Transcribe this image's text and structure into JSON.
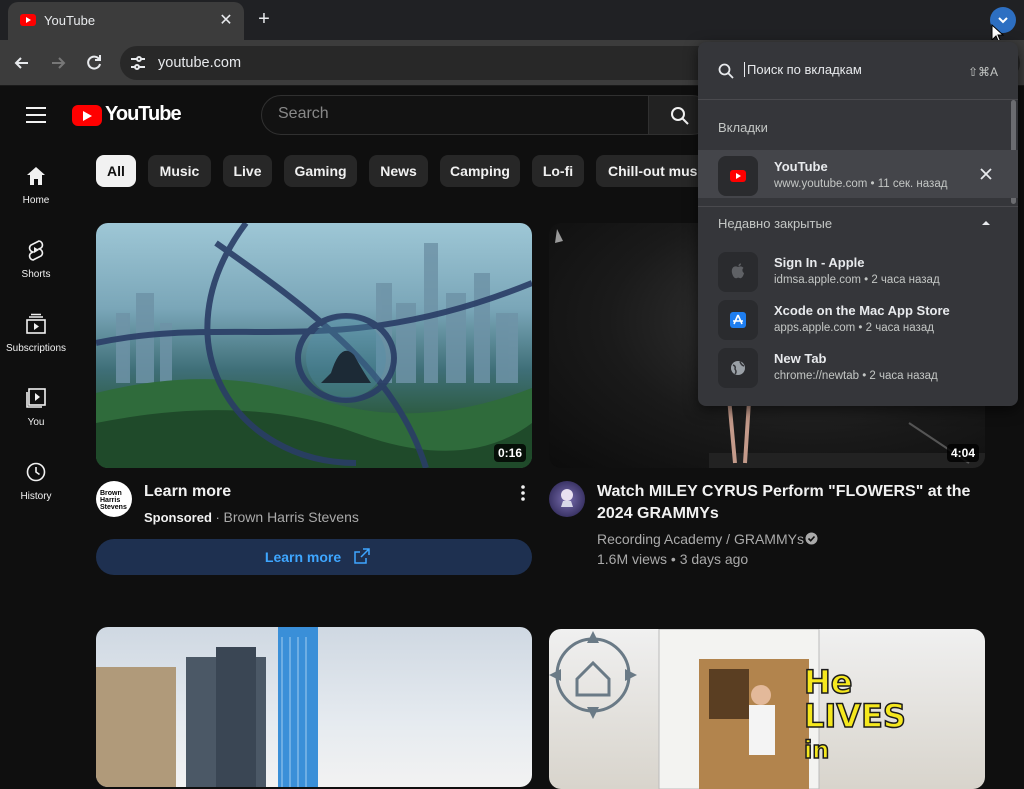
{
  "browser": {
    "tab_title": "YouTube",
    "tab_close": "✕",
    "new_tab": "+",
    "url": "youtube.com"
  },
  "youtube": {
    "logo_text": "YouTube",
    "search_placeholder": "Search",
    "sidebar": [
      {
        "label": "Home",
        "icon": "home-icon"
      },
      {
        "label": "Shorts",
        "icon": "shorts-icon"
      },
      {
        "label": "Subscriptions",
        "icon": "subscriptions-icon"
      },
      {
        "label": "You",
        "icon": "you-icon"
      },
      {
        "label": "History",
        "icon": "history-icon"
      }
    ],
    "chips": [
      "All",
      "Music",
      "Live",
      "Gaming",
      "News",
      "Camping",
      "Lo-fi",
      "Chill-out music"
    ],
    "videos": [
      {
        "title": "Learn more",
        "sponsored": "Sponsored",
        "dot": "·",
        "advertiser": "Brown Harris Stevens",
        "avatar_text": "Brown Harris Stevens",
        "duration": "0:16",
        "cta": "Learn more"
      },
      {
        "title": "Watch MILEY CYRUS Perform \"FLOWERS\" at the 2024 GRAMMYs",
        "channel": "Recording Academy / GRAMMYs",
        "stats": "1.6M views • 3 days ago",
        "duration": "4:04"
      },
      {
        "overlay_text_1": "He",
        "overlay_text_2": "LIVES",
        "overlay_text_3": "in"
      }
    ]
  },
  "tab_search": {
    "placeholder": "Поиск по вкладкам",
    "shortcut": "⇧⌘A",
    "open_tabs_header": "Вкладки",
    "open_tabs": [
      {
        "title": "YouTube",
        "subtitle": "www.youtube.com • 11 сек. назад"
      }
    ],
    "recently_closed_header": "Недавно закрытые",
    "recently_closed": [
      {
        "title": "Sign In - Apple",
        "subtitle": "idmsa.apple.com • 2 часа назад"
      },
      {
        "title": "Xcode on the Mac App Store",
        "subtitle": "apps.apple.com • 2 часа назад"
      },
      {
        "title": "New Tab",
        "subtitle": "chrome://newtab • 2 часа назад"
      }
    ]
  },
  "colors": {
    "youtube_red": "#ff0000",
    "link_blue": "#3ea6ff",
    "chrome_accent": "#2d6fc2"
  }
}
